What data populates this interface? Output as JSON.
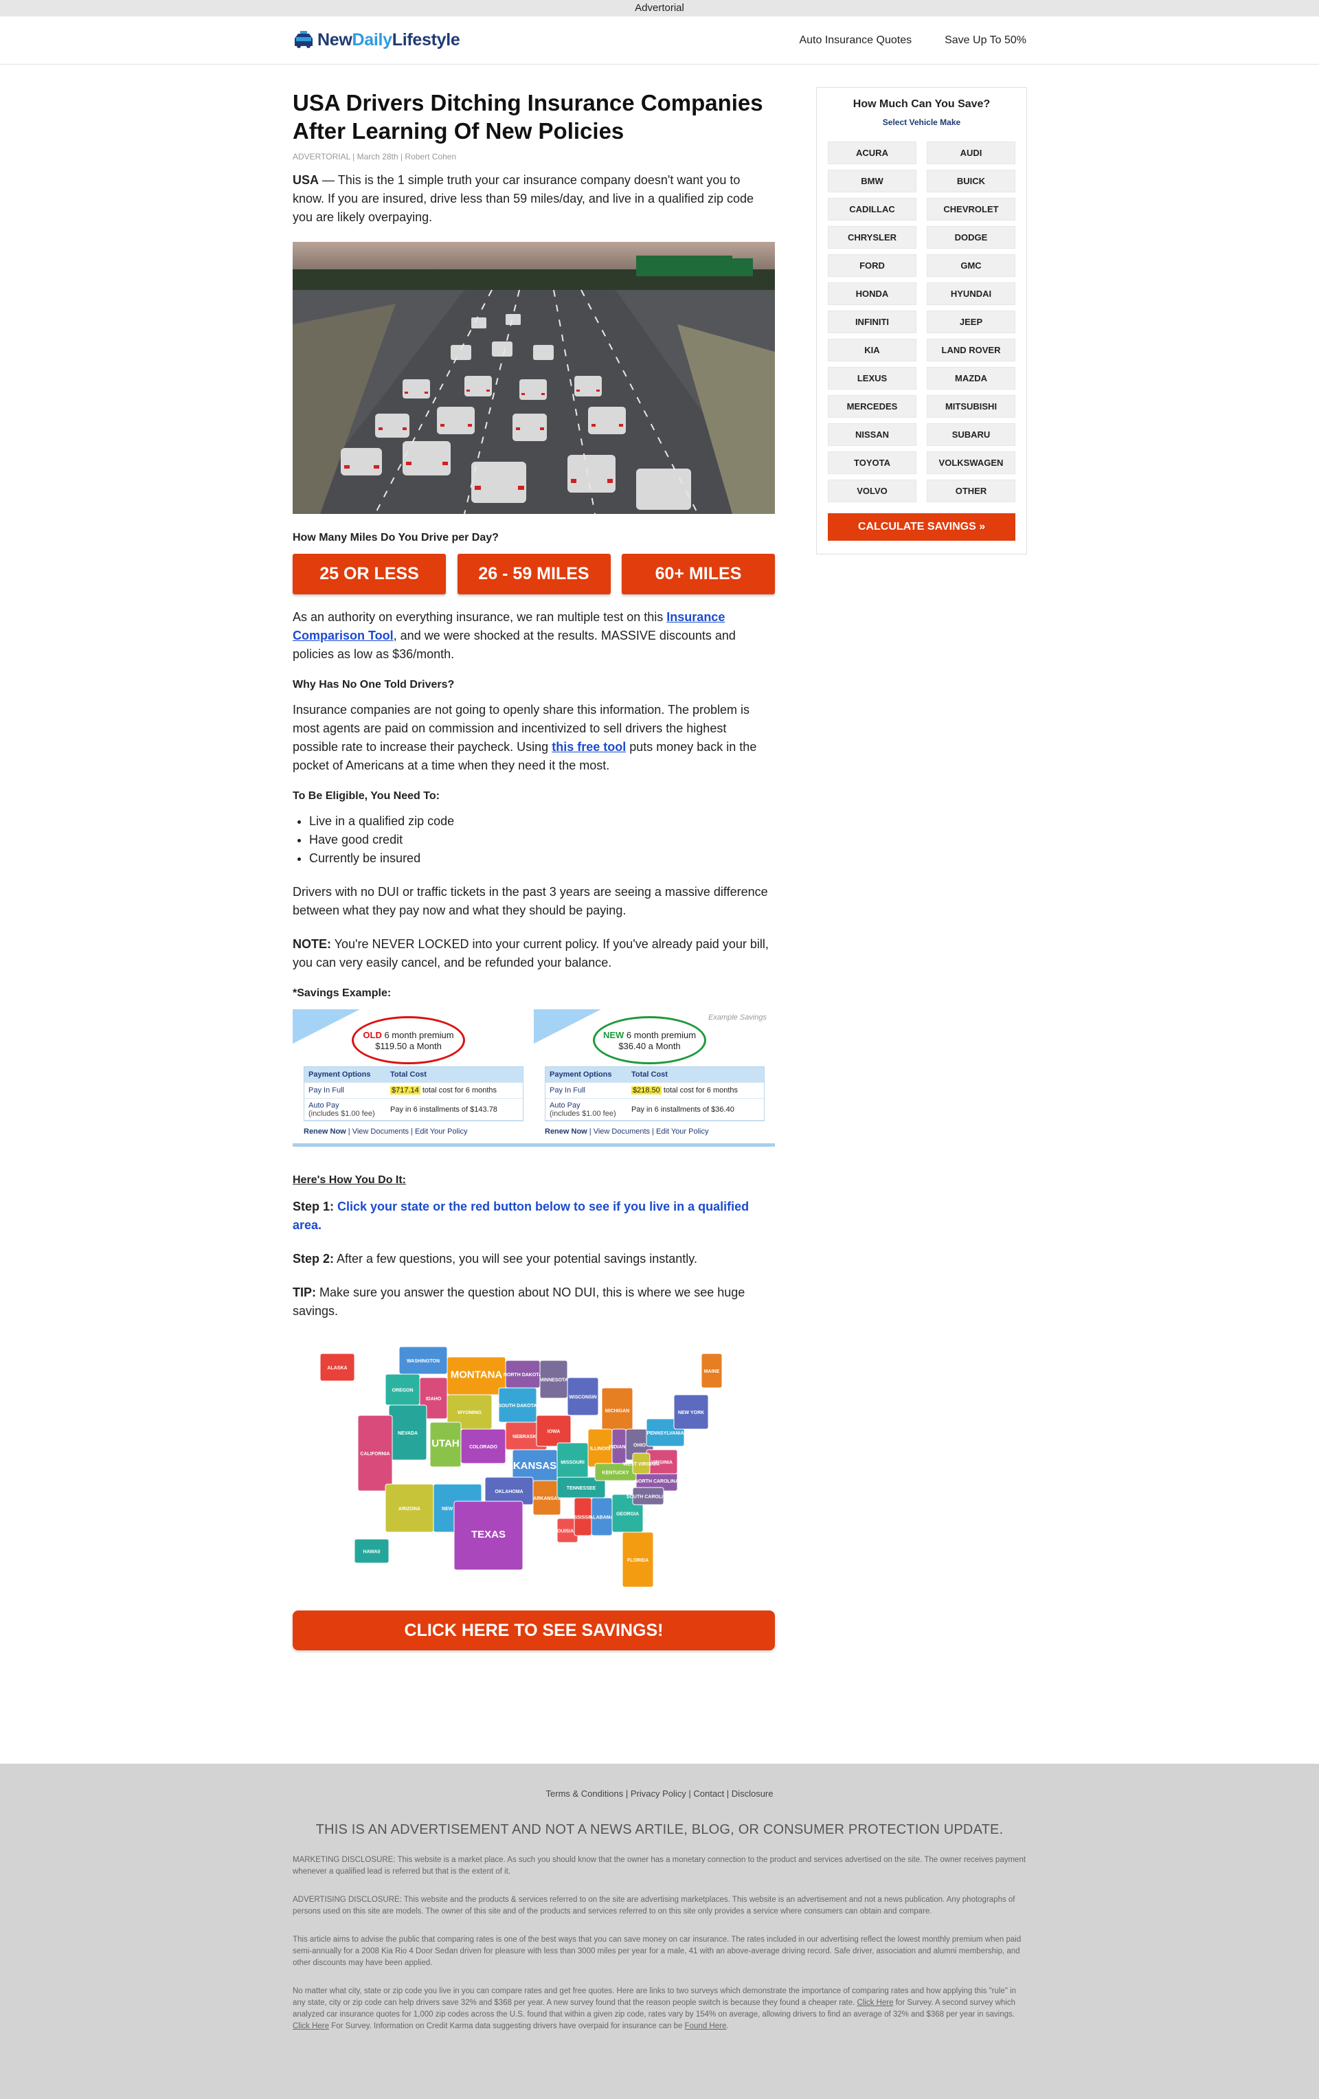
{
  "adbar": {
    "label": "Advertorial"
  },
  "header": {
    "logo": {
      "part1": "New",
      "part2": "Daily",
      "part3": "Lifestyle"
    },
    "nav": [
      "Auto Insurance Quotes",
      "Save Up To 50%"
    ]
  },
  "article": {
    "title": "USA Drivers Ditching Insurance Companies After Learning Of New Policies",
    "byline": "ADVERTORIAL | March 28th | Robert Cohen",
    "intro_lead": "USA",
    "intro_text": " — This is the 1 simple truth your car insurance company doesn't want you to know. If you are insured, drive less than 59 miles/day, and live in a qualified zip code you are likely overpaying.",
    "miles_question": "How Many Miles Do You Drive per Day?",
    "miles_buttons": [
      "25 OR LESS",
      "26 - 59 MILES",
      "60+ MILES"
    ],
    "p_authority_1": "As an authority on everything insurance, we ran multiple test on this ",
    "p_authority_link": "Insurance Comparison Tool",
    "p_authority_2": ", and we were shocked at the results. MASSIVE discounts and policies as low as $36/month.",
    "h_no_one": "Why Has No One Told Drivers?",
    "p_no_one_1": "Insurance companies are not going to openly share this information. The problem is most agents are paid on commission and incentivized to sell drivers the highest possible rate to increase their paycheck. Using ",
    "p_no_one_link": "this free tool",
    "p_no_one_2": " puts money back in the pocket of Americans at a time when they need it the most.",
    "h_eligible": "To Be Eligible, You Need To:",
    "eligible": [
      "Live in a qualified zip code",
      "Have good credit",
      "Currently be insured"
    ],
    "p_dui": "Drivers with no DUI or traffic tickets in the past 3 years are seeing a massive difference between what they pay now and what they should be paying.",
    "note_label": "NOTE:",
    "note_text": " You're NEVER LOCKED into your current policy. If you've already paid your bill, you can very easily cancel, and be refunded your balance.",
    "h_savings": "*Savings Example:",
    "savings": {
      "old": {
        "tag": "OLD",
        "line1": " 6 month premium",
        "line2": "$119.50 a Month",
        "payfull": "$717.14",
        "autopay": "Pay in 6 installments of $143.78"
      },
      "new": {
        "tag": "NEW",
        "line1": " 6 month premium",
        "line2": "$36.40 a Month",
        "payfull": "$218.50",
        "autopay": "Pay in 6 installments of $36.40"
      },
      "col1": "Payment Options",
      "col2": "Total Cost",
      "row1": "Pay In Full",
      "row1_suffix": " total cost for 6 months",
      "row2a": "Auto Pay",
      "row2b": "(includes $1.00 fee)",
      "link1": "Renew Now",
      "link2": "View Documents",
      "link3": "Edit Your Policy",
      "example": "Example Savings"
    },
    "h_howto": "Here's How You Do It:",
    "step1_label": "Step 1:",
    "step1_text": " Click your state or the red button below to see if you live in a qualified area.",
    "step2_label": "Step 2:",
    "step2_text": " After a few questions, you will see your potential savings instantly.",
    "tip_label": "TIP:",
    "tip_text": " Make sure you answer the question about NO DUI, this is where we see huge savings.",
    "map_states": [
      "ALASKA",
      "WASHINGTON",
      "OREGON",
      "MONTANA",
      "NORTH DAKOTA",
      "MINNESOTA",
      "IDAHO",
      "WYOMING",
      "SOUTH DAKOTA",
      "WISCONSIN",
      "MICHIGAN",
      "NEVADA",
      "UTAH",
      "COLORADO",
      "NEBRASKA",
      "IOWA",
      "KANSAS",
      "MISSOURI",
      "ILLINOIS",
      "INDIANA",
      "OHIO",
      "CALIFORNIA",
      "ARIZONA",
      "NEW MEXICO",
      "OKLAHOMA",
      "ARKANSAS",
      "TENNESSEE",
      "KENTUCKY",
      "TEXAS",
      "LOUISIANA",
      "MISSISSIPPI",
      "ALABAMA",
      "GEORGIA",
      "FLORIDA",
      "NORTH CAROLINA",
      "SOUTH CAROLINA",
      "VIRGINIA",
      "WEST VIRGINIA",
      "PENNSYLVANIA",
      "NEW YORK",
      "MAINE",
      "HAWAII"
    ],
    "cta": "CLICK HERE TO SEE SAVINGS!"
  },
  "sidebar": {
    "title": "How Much Can You Save?",
    "subtitle": "Select Vehicle Make",
    "makes": [
      "ACURA",
      "AUDI",
      "BMW",
      "BUICK",
      "CADILLAC",
      "CHEVROLET",
      "CHRYSLER",
      "DODGE",
      "FORD",
      "GMC",
      "HONDA",
      "HYUNDAI",
      "INFINITI",
      "JEEP",
      "KIA",
      "LAND ROVER",
      "LEXUS",
      "MAZDA",
      "MERCEDES",
      "MITSUBISHI",
      "NISSAN",
      "SUBARU",
      "TOYOTA",
      "VOLKSWAGEN",
      "VOLVO",
      "OTHER"
    ],
    "button": "CALCULATE SAVINGS »"
  },
  "footer": {
    "links": [
      "Terms & Conditions",
      "Privacy Policy",
      "Contact",
      "Disclosure"
    ],
    "headline": "THIS IS AN ADVERTISEMENT AND NOT A NEWS ARTILE, BLOG, OR CONSUMER PROTECTION UPDATE.",
    "marketing": "MARKETING DISCLOSURE: This website is a market place. As such you should know that the owner has a monetary connection to the product and services advertised on the site. The owner receives payment whenever a qualified lead is referred but that is the extent of it.",
    "advertising": "ADVERTISING DISCLOSURE: This website and the products & services referred to on the site are advertising marketplaces. This website is an advertisement and not a news publication. Any photographs of persons used on this site are models. The owner of this site and of the products and services referred to on this site only provides a service where consumers can obtain and compare.",
    "article_note": "This article aims to advise the public that comparing rates is one of the best ways that you can save money on car insurance. The rates included in our advertising reflect the lowest monthly premium when paid semi-annually for a 2008 Kia Rio 4 Door Sedan driven for pleasure with less than 3000 miles per year for a male, 41 with an above-average driving record. Safe driver, association and alumni membership, and other discounts may have been applied.",
    "survey_1": "No matter what city, state or zip code you live in you can compare rates and get free quotes. Here are links to two surveys which demonstrate the importance of comparing rates and how applying this \"rule\" in any state, city or zip code can help drivers save 32% and $368 per year. A new survey found that the reason people switch is because they found a cheaper rate. ",
    "survey_link1": "Click Here",
    "survey_2": " for Survey. A second survey which analyzed car insurance quotes for 1,000 zip codes across the U.S. found that within a given zip code, rates vary by 154% on average, allowing drivers to find an average of 32% and $368 per year in savings. ",
    "survey_link2": "Click Here",
    "survey_3": " For Survey. Information on Credit Karma data suggesting drivers have overpaid for insurance can be ",
    "survey_link3": "Found Here",
    "survey_4": "."
  }
}
